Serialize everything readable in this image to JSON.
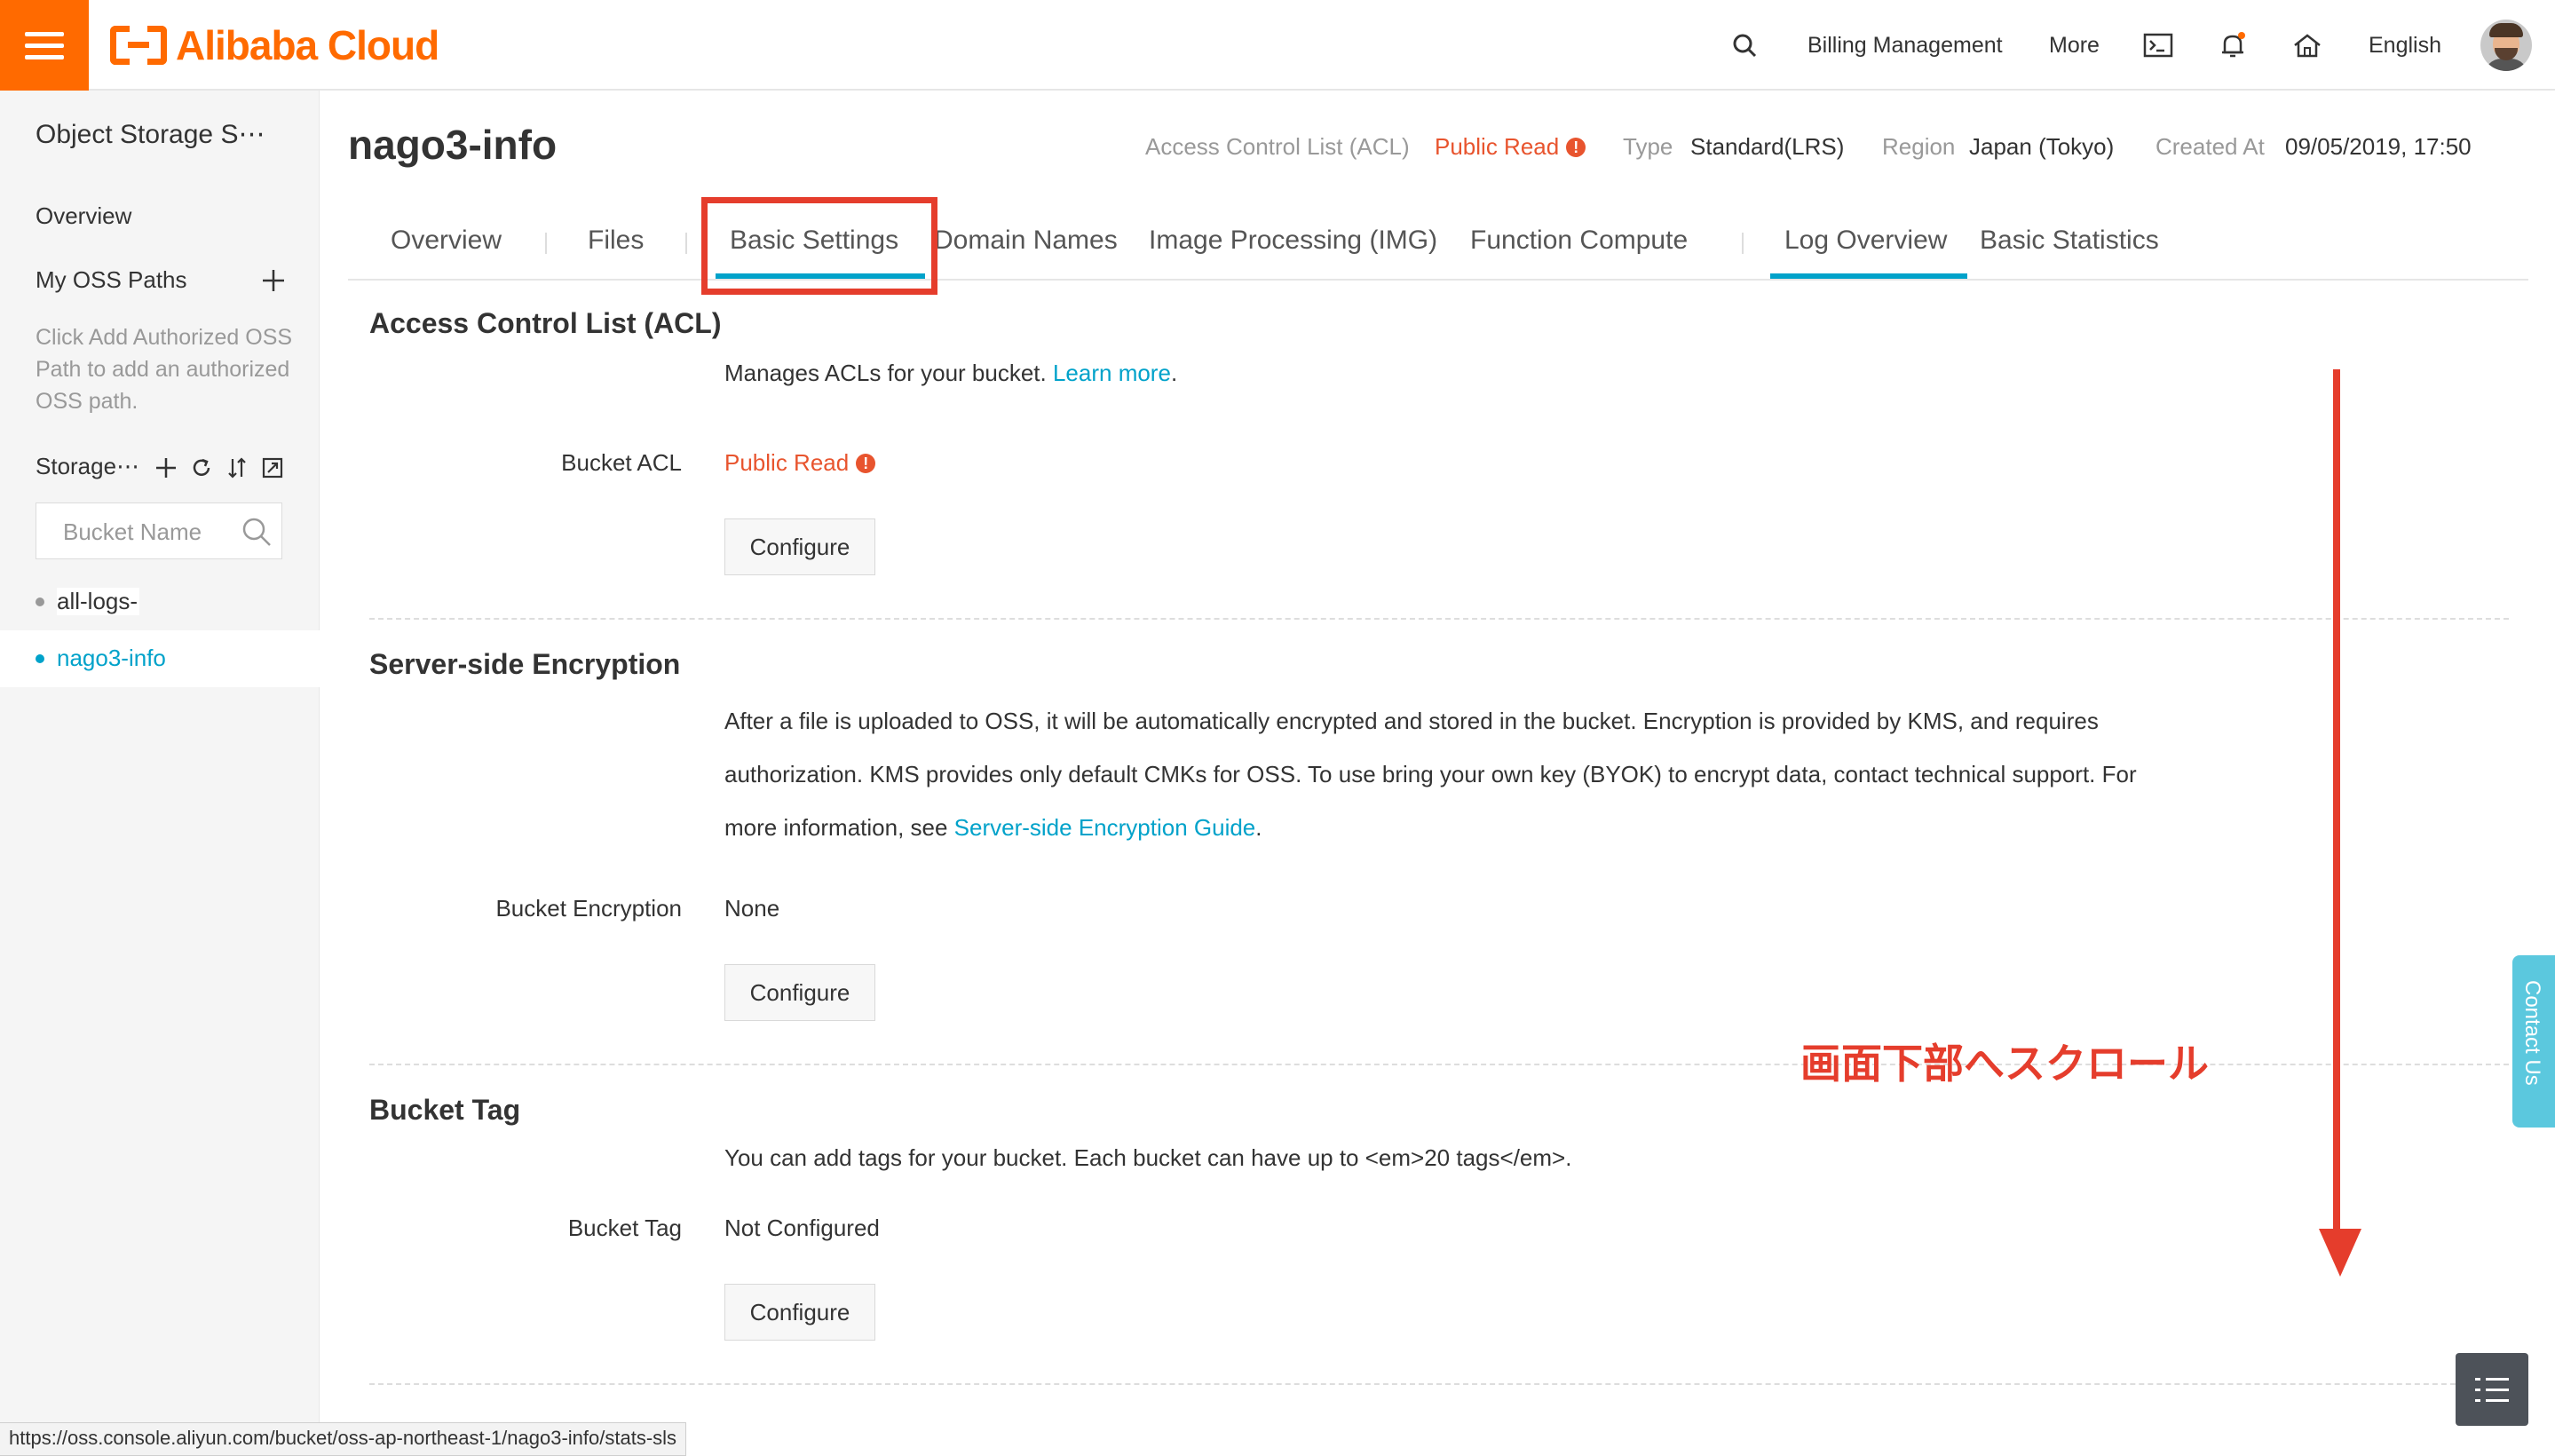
{
  "topbar": {
    "logo_text": "Alibaba Cloud",
    "billing": "Billing Management",
    "more": "More",
    "language": "English"
  },
  "sidebar": {
    "title": "Object Storage S⋯",
    "overview": "Overview",
    "my_oss_paths": "My OSS Paths",
    "hint": "Click Add Authorized OSS Path to add an authorized OSS path.",
    "storage_label": "Storage⋯",
    "search_placeholder": "Bucket Name",
    "buckets": [
      {
        "name": "all-logs-",
        "active": false
      },
      {
        "name": "nago3-info",
        "active": true
      }
    ]
  },
  "header": {
    "bucket_name": "nago3-info",
    "acl_label": "Access Control List (ACL)",
    "acl_value": "Public Read",
    "type_label": "Type",
    "type_value": "Standard(LRS)",
    "region_label": "Region",
    "region_value": "Japan (Tokyo)",
    "created_label": "Created At",
    "created_value": "09/05/2019, 17:50"
  },
  "tabs": [
    {
      "label": "Overview"
    },
    {
      "label": "Files"
    },
    {
      "label": "Basic Settings",
      "active": true
    },
    {
      "label": "Domain Names"
    },
    {
      "label": "Image Processing (IMG)"
    },
    {
      "label": "Function Compute"
    },
    {
      "label": "Log Overview"
    },
    {
      "label": "Basic Statistics"
    }
  ],
  "acl_section": {
    "title": "Access Control List (ACL)",
    "desc": "Manages ACLs for your bucket. ",
    "learn_more": "Learn more",
    "desc_end": ".",
    "label": "Bucket ACL",
    "value": "Public Read",
    "button": "Configure"
  },
  "sse_section": {
    "title": "Server-side Encryption",
    "desc": "After a file is uploaded to OSS, it will be automatically encrypted and stored in the bucket. Encryption is provided by KMS, and requires authorization. KMS provides only default CMKs for OSS. To use bring your own key (BYOK) to encrypt data, contact technical support. For more information, see ",
    "link": "Server-side Encryption Guide",
    "desc_end": ".",
    "label": "Bucket Encryption",
    "value": "None",
    "button": "Configure"
  },
  "tag_section": {
    "title": "Bucket Tag",
    "desc": "You can add tags for your bucket. Each bucket can have up to <em>20 tags</em>.",
    "label": "Bucket Tag",
    "value": "Not Configured",
    "button": "Configure"
  },
  "annotation": "画面下部へスクロール",
  "contact_us": "Contact Us",
  "status_url": "https://oss.console.aliyun.com/bucket/oss-ap-northeast-1/nago3-info/stats-sls",
  "colors": {
    "brand": "#ff6a00",
    "link": "#00a2ca",
    "warning": "#e8542e",
    "annotation": "#e53d2c"
  }
}
